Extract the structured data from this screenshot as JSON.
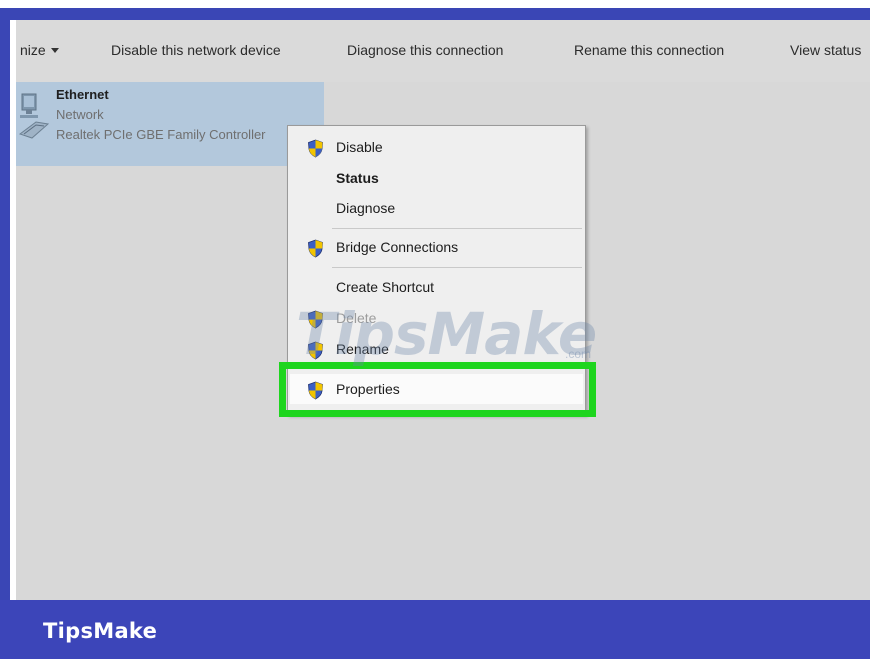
{
  "toolbar": {
    "organize_label": "nize",
    "disable_device_label": "Disable this network device",
    "diagnose_label": "Diagnose this connection",
    "rename_label": "Rename this connection",
    "view_status_label": "View status"
  },
  "connection": {
    "name": "Ethernet",
    "status": "Network",
    "device": "Realtek PCIe GBE Family Controller"
  },
  "context_menu": {
    "items": [
      {
        "label": "Disable",
        "icon": "shield-icon"
      },
      {
        "label": "Status"
      },
      {
        "label": "Diagnose"
      },
      {
        "label": "Bridge Connections",
        "icon": "shield-icon"
      },
      {
        "label": "Create Shortcut"
      },
      {
        "label": "Delete",
        "icon": "shield-icon"
      },
      {
        "label": "Rename",
        "icon": "shield-icon"
      },
      {
        "label": "Properties",
        "icon": "shield-icon"
      }
    ]
  },
  "watermark": {
    "text": "TipsMake",
    "suffix": ".com"
  },
  "footer": {
    "brand": "TipsMake"
  },
  "colors": {
    "frame_blue": "#3a46b5",
    "highlight_green": "#1ed51e",
    "selection_blue": "#b3c8dc",
    "window_gray": "#d8d8d8"
  }
}
